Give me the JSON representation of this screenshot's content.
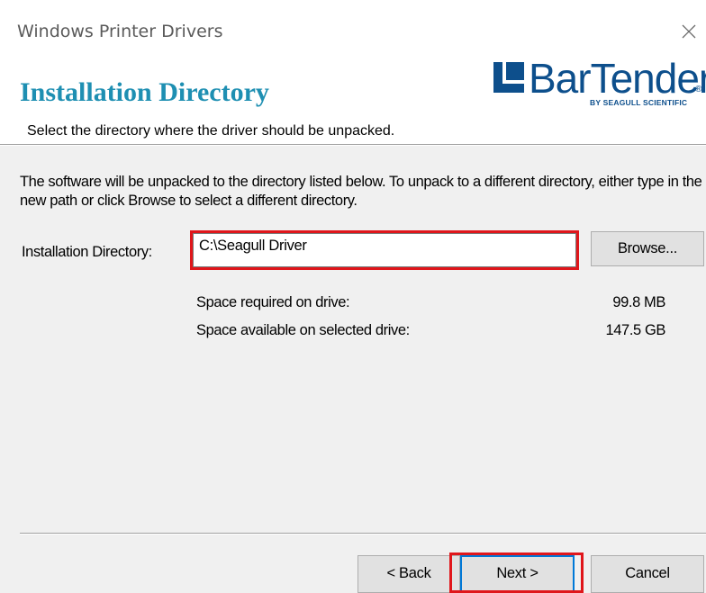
{
  "window": {
    "title": "Windows Printer Drivers"
  },
  "header": {
    "title": "Installation Directory",
    "subtitle": "Select the directory where the driver should be unpacked.",
    "logo": {
      "name": "BarTender",
      "registered_mark": "®",
      "tagline": "BY SEAGULL SCIENTIFIC"
    }
  },
  "main": {
    "description": "The software will be unpacked to the directory listed below.  To unpack to a different directory, either type in the new path or click Browse to select a different directory.",
    "directory_label": "Installation Directory:",
    "directory_value": "C:\\Seagull Driver",
    "browse_label": "Browse...",
    "space_required_label": "Space required on drive:",
    "space_required_value": "99.8 MB",
    "space_available_label": "Space available on selected drive:",
    "space_available_value": "147.5 GB"
  },
  "footer": {
    "back_label": "< Back",
    "next_label": "Next >",
    "cancel_label": "Cancel"
  },
  "colors": {
    "title_accent": "#1e8fb2",
    "brand": "#0d4f8c",
    "highlight": "#e0161b",
    "dialog_bg": "#f0f0f0"
  },
  "icons": {
    "close": "close-icon",
    "logo_mark": "bartender-logo-mark-icon"
  }
}
